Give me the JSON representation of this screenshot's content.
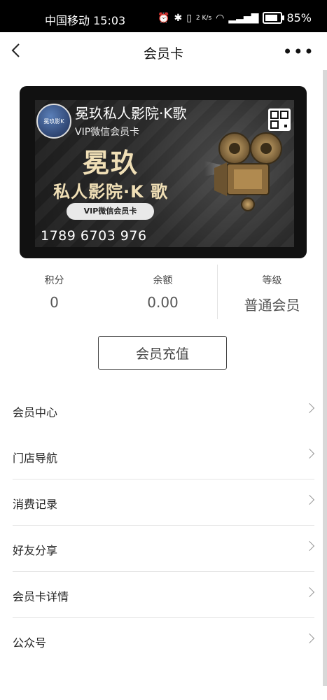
{
  "status_bar": {
    "carrier_time": "中国移动 15:03",
    "net_speed": "2 K/s",
    "battery_percent": "85%",
    "battery_level": 0.85
  },
  "navbar": {
    "title": "会员卡",
    "more": "•••"
  },
  "card": {
    "store_name": "冕玖私人影院·K歌",
    "subtitle": "VIP微信会员卡",
    "big_title": "冕玖",
    "big_subtitle": "私人影院·K 歌",
    "pill_label": "VIP微信会员卡",
    "card_number": "1789 6703 976",
    "logo_text": "冕玖影K"
  },
  "stats": [
    {
      "label": "积分",
      "value": "0"
    },
    {
      "label": "余额",
      "value": "0.00"
    },
    {
      "label": "等级",
      "value": "普通会员"
    }
  ],
  "recharge_button": "会员充值",
  "menu": [
    {
      "label": "会员中心"
    },
    {
      "label": "门店导航"
    },
    {
      "label": "消费记录"
    },
    {
      "label": "好友分享"
    },
    {
      "label": "会员卡详情"
    },
    {
      "label": "公众号"
    }
  ]
}
